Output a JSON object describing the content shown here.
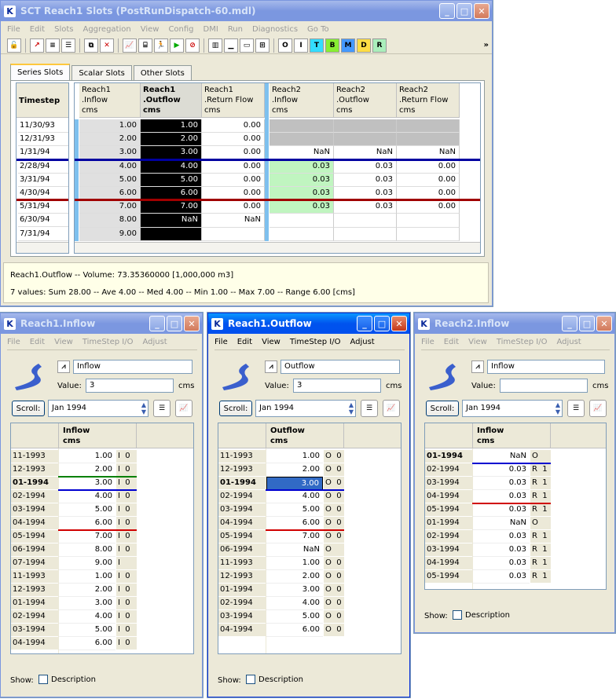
{
  "main": {
    "title": "SCT Reach1 Slots (PostRunDispatch-60.mdl)",
    "menu": [
      "File",
      "Edit",
      "Slots",
      "Aggregation",
      "View",
      "Config",
      "DMI",
      "Run",
      "Diagnostics",
      "Go To"
    ],
    "toolbar_letters": [
      "O",
      "I",
      "T",
      "B",
      "M",
      "D",
      "R"
    ],
    "tabs": [
      "Series Slots",
      "Scalar Slots",
      "Other Slots"
    ],
    "timestep_header": "Timestep",
    "columns": [
      {
        "l1": "Reach1",
        "l2": ".Inflow",
        "l3": "cms",
        "values": [
          "1.00",
          "2.00",
          "3.00",
          "4.00",
          "5.00",
          "6.00",
          "7.00",
          "8.00",
          "9.00"
        ]
      },
      {
        "l1": "Reach1",
        "l2": ".Outflow",
        "l3": "cms",
        "values": [
          "1.00",
          "2.00",
          "3.00",
          "4.00",
          "5.00",
          "6.00",
          "7.00",
          "NaN",
          ""
        ]
      },
      {
        "l1": "Reach1",
        "l2": ".Return Flow",
        "l3": "cms",
        "values": [
          "0.00",
          "0.00",
          "0.00",
          "0.00",
          "0.00",
          "0.00",
          "0.00",
          "NaN",
          ""
        ]
      },
      {
        "l1": "Reach2",
        "l2": ".Inflow",
        "l3": "cms",
        "values": [
          "",
          "",
          "NaN",
          "0.03",
          "0.03",
          "0.03",
          "0.03",
          "",
          ""
        ]
      },
      {
        "l1": "Reach2",
        "l2": ".Outflow",
        "l3": "cms",
        "values": [
          "",
          "",
          "NaN",
          "0.03",
          "0.03",
          "0.03",
          "0.03",
          "",
          ""
        ]
      },
      {
        "l1": "Reach2",
        "l2": ".Return Flow",
        "l3": "cms",
        "values": [
          "",
          "",
          "NaN",
          "0.00",
          "0.00",
          "0.00",
          "0.00",
          "",
          ""
        ]
      }
    ],
    "timesteps": [
      "11/30/93",
      "12/31/93",
      "1/31/94",
      "2/28/94",
      "3/31/94",
      "4/30/94",
      "5/31/94",
      "6/30/94",
      "7/31/94"
    ],
    "status1": "Reach1.Outflow -- Volume: 73.35360000 [1,000,000 m3]",
    "status2": "7 values:  Sum 28.00 -- Ave 4.00 -- Med 4.00 -- Min 1.00 -- Max 7.00 -- Range 6.00 [cms]"
  },
  "w1": {
    "title": "Reach1.Inflow",
    "menu": [
      "File",
      "Edit",
      "View",
      "TimeStep I/O",
      "Adjust"
    ],
    "slot_name": "Inflow",
    "value_label": "Value:",
    "value": "3",
    "units": "cms",
    "scroll_label": "Scroll:",
    "scroll_date": "Jan 1994",
    "col_l1": "Inflow",
    "col_l2": "cms",
    "rows": [
      {
        "d": "11-1993",
        "v": "1.00",
        "f": "I  0"
      },
      {
        "d": "12-1993",
        "v": "2.00",
        "f": "I  0"
      },
      {
        "d": "01-1994",
        "v": "3.00",
        "f": "I  0"
      },
      {
        "d": "02-1994",
        "v": "4.00",
        "f": "I  0"
      },
      {
        "d": "03-1994",
        "v": "5.00",
        "f": "I  0"
      },
      {
        "d": "04-1994",
        "v": "6.00",
        "f": "I  0"
      },
      {
        "d": "05-1994",
        "v": "7.00",
        "f": "I  0"
      },
      {
        "d": "06-1994",
        "v": "8.00",
        "f": "I  0"
      },
      {
        "d": "07-1994",
        "v": "9.00",
        "f": "I"
      },
      {
        "d": "11-1993",
        "v": "1.00",
        "f": "I  0"
      },
      {
        "d": "12-1993",
        "v": "2.00",
        "f": "I  0"
      },
      {
        "d": "01-1994",
        "v": "3.00",
        "f": "I  0"
      },
      {
        "d": "02-1994",
        "v": "4.00",
        "f": "I  0"
      },
      {
        "d": "03-1994",
        "v": "5.00",
        "f": "I  0"
      },
      {
        "d": "04-1994",
        "v": "6.00",
        "f": "I  0"
      }
    ],
    "show_label": "Show:",
    "desc_label": "Description"
  },
  "w2": {
    "title": "Reach1.Outflow",
    "menu": [
      "File",
      "Edit",
      "View",
      "TimeStep I/O",
      "Adjust"
    ],
    "slot_name": "Outflow",
    "value_label": "Value:",
    "value": "3",
    "units": "cms",
    "scroll_label": "Scroll:",
    "scroll_date": "Jan 1994",
    "col_l1": "Outflow",
    "col_l2": "cms",
    "rows": [
      {
        "d": "11-1993",
        "v": "1.00",
        "f": "O  0"
      },
      {
        "d": "12-1993",
        "v": "2.00",
        "f": "O  0"
      },
      {
        "d": "01-1994",
        "v": "3.00",
        "f": "O  0"
      },
      {
        "d": "02-1994",
        "v": "4.00",
        "f": "O  0"
      },
      {
        "d": "03-1994",
        "v": "5.00",
        "f": "O  0"
      },
      {
        "d": "04-1994",
        "v": "6.00",
        "f": "O  0"
      },
      {
        "d": "05-1994",
        "v": "7.00",
        "f": "O  0"
      },
      {
        "d": "06-1994",
        "v": "NaN",
        "f": "O"
      },
      {
        "d": "11-1993",
        "v": "1.00",
        "f": "O  0"
      },
      {
        "d": "12-1993",
        "v": "2.00",
        "f": "O  0"
      },
      {
        "d": "01-1994",
        "v": "3.00",
        "f": "O  0"
      },
      {
        "d": "02-1994",
        "v": "4.00",
        "f": "O  0"
      },
      {
        "d": "03-1994",
        "v": "5.00",
        "f": "O  0"
      },
      {
        "d": "04-1994",
        "v": "6.00",
        "f": "O  0"
      }
    ],
    "show_label": "Show:",
    "desc_label": "Description"
  },
  "w3": {
    "title": "Reach2.Inflow",
    "menu": [
      "File",
      "Edit",
      "View",
      "TimeStep I/O",
      "Adjust"
    ],
    "slot_name": "Inflow",
    "value_label": "Value:",
    "value": "",
    "units": "cms",
    "scroll_label": "Scroll:",
    "scroll_date": "Jan 1994",
    "col_l1": "Inflow",
    "col_l2": "cms",
    "rows": [
      {
        "d": "01-1994",
        "v": "NaN",
        "f": "O"
      },
      {
        "d": "02-1994",
        "v": "0.03",
        "f": "R  1"
      },
      {
        "d": "03-1994",
        "v": "0.03",
        "f": "R  1"
      },
      {
        "d": "04-1994",
        "v": "0.03",
        "f": "R  1"
      },
      {
        "d": "05-1994",
        "v": "0.03",
        "f": "R  1"
      },
      {
        "d": "01-1994",
        "v": "NaN",
        "f": "O"
      },
      {
        "d": "02-1994",
        "v": "0.03",
        "f": "R  1"
      },
      {
        "d": "03-1994",
        "v": "0.03",
        "f": "R  1"
      },
      {
        "d": "04-1994",
        "v": "0.03",
        "f": "R  1"
      },
      {
        "d": "05-1994",
        "v": "0.03",
        "f": "R  1"
      }
    ],
    "show_label": "Show:",
    "desc_label": "Description"
  }
}
